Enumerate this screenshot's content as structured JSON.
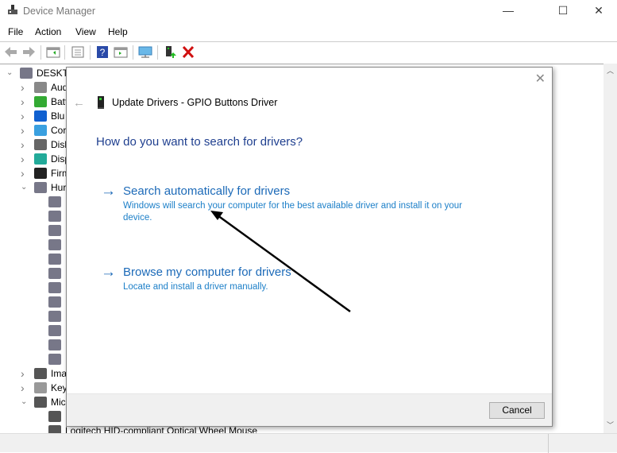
{
  "window": {
    "title": "Device Manager",
    "minimize": "—",
    "maximize": "☐",
    "close": "✕"
  },
  "menu": [
    "File",
    "Action",
    "View",
    "Help"
  ],
  "toolbar": [
    "back-icon",
    "forward-icon",
    "properties-window-icon",
    "device-list-icon",
    "help-icon",
    "action-pane-icon",
    "scan-hardware-icon",
    "update-driver-icon",
    "uninstall-icon"
  ],
  "tree": {
    "root": "DESKTO",
    "categories": [
      {
        "label": "Aud",
        "icon": "audio-icon",
        "expanded": false
      },
      {
        "label": "Batt",
        "icon": "battery-icon",
        "expanded": false
      },
      {
        "label": "Blu",
        "icon": "bluetooth-icon",
        "expanded": false
      },
      {
        "label": "Cor",
        "icon": "monitor-icon",
        "expanded": false
      },
      {
        "label": "Disk",
        "icon": "disk-icon",
        "expanded": false
      },
      {
        "label": "Disp",
        "icon": "display-adapter-icon",
        "expanded": false
      },
      {
        "label": "Firm",
        "icon": "firmware-icon",
        "expanded": false
      },
      {
        "label": "Hur",
        "icon": "hid-icon",
        "expanded": true,
        "children": 12
      },
      {
        "label": "Ima",
        "icon": "camera-icon",
        "expanded": false
      },
      {
        "label": "Key",
        "icon": "keyboard-icon",
        "expanded": false
      },
      {
        "label": "Mic",
        "icon": "mouse-icon",
        "expanded": true
      }
    ],
    "last_row": "Logitech HID-compliant Optical Wheel Mouse"
  },
  "dialog": {
    "close": "✕",
    "back": "←",
    "title": "Update Drivers - GPIO Buttons Driver",
    "question": "How do you want to search for drivers?",
    "options": [
      {
        "arrow": "→",
        "heading": "Search automatically for drivers",
        "desc": "Windows will search your computer for the best available driver and install it on your device."
      },
      {
        "arrow": "→",
        "heading": "Browse my computer for drivers",
        "desc": "Locate and install a driver manually."
      }
    ],
    "cancel": "Cancel"
  },
  "colors": {
    "link": "#1c6ab8",
    "question": "#1f3f8f"
  }
}
